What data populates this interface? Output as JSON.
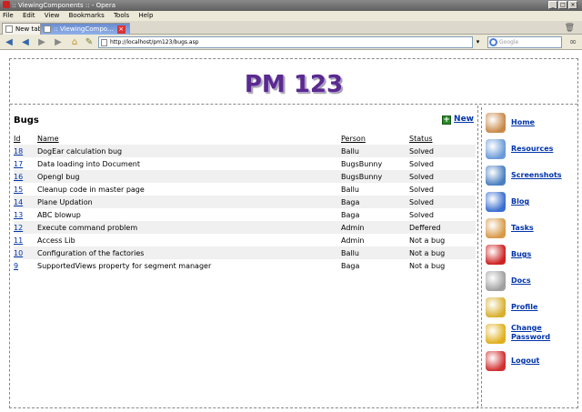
{
  "window": {
    "title": ":: ViewingComponents :: - Opera"
  },
  "menu": [
    "File",
    "Edit",
    "View",
    "Bookmarks",
    "Tools",
    "Help"
  ],
  "tabs": [
    {
      "label": "New tab",
      "active": false
    },
    {
      "label": ":: ViewingCompo...",
      "active": true
    }
  ],
  "address": {
    "url": "http://localhost/pm123/bugs.asp",
    "search_placeholder": "Google"
  },
  "site": {
    "logo": "PM 123"
  },
  "bugs": {
    "title": "Bugs",
    "new_label": "New",
    "columns": [
      "Id",
      "Name",
      "Person",
      "Status"
    ],
    "rows": [
      {
        "id": "18",
        "name": "DogEar calculation bug",
        "person": "Ballu",
        "status": "Solved"
      },
      {
        "id": "17",
        "name": "Data loading into Document",
        "person": "BugsBunny",
        "status": "Solved"
      },
      {
        "id": "16",
        "name": "Opengl bug",
        "person": "BugsBunny",
        "status": "Solved"
      },
      {
        "id": "15",
        "name": "Cleanup code in master page",
        "person": "Ballu",
        "status": "Solved"
      },
      {
        "id": "14",
        "name": "Plane Updation",
        "person": "Baga",
        "status": "Solved"
      },
      {
        "id": "13",
        "name": "ABC blowup",
        "person": "Baga",
        "status": "Solved"
      },
      {
        "id": "12",
        "name": "Execute command problem",
        "person": "Admin",
        "status": "Deffered"
      },
      {
        "id": "11",
        "name": "Access Lib",
        "person": "Admin",
        "status": "Not a bug"
      },
      {
        "id": "10",
        "name": "Configuration of the factories",
        "person": "Ballu",
        "status": "Not a bug"
      },
      {
        "id": "9",
        "name": "SupportedViews property for segment manager",
        "person": "Baga",
        "status": "Not a bug"
      }
    ]
  },
  "sidebar": {
    "items": [
      {
        "label": "Home",
        "icon": "house-icon",
        "color": "#c8894a"
      },
      {
        "label": "Resources",
        "icon": "people-icon",
        "color": "#6a9bd8"
      },
      {
        "label": "Screenshots",
        "icon": "monitor-icon",
        "color": "#4a7fc0"
      },
      {
        "label": "Blog",
        "icon": "globe-pen-icon",
        "color": "#3b6fd0"
      },
      {
        "label": "Tasks",
        "icon": "user-task-icon",
        "color": "#d89a4a"
      },
      {
        "label": "Bugs",
        "icon": "ladybug-icon",
        "color": "#cc2222"
      },
      {
        "label": "Docs",
        "icon": "document-icon",
        "color": "#a0a0a0"
      },
      {
        "label": "Profile",
        "icon": "keys-icon",
        "color": "#d8b030"
      },
      {
        "label": "Change Password",
        "icon": "key-icon",
        "color": "#e0b020"
      },
      {
        "label": "Logout",
        "icon": "power-icon",
        "color": "#d03030"
      }
    ]
  }
}
